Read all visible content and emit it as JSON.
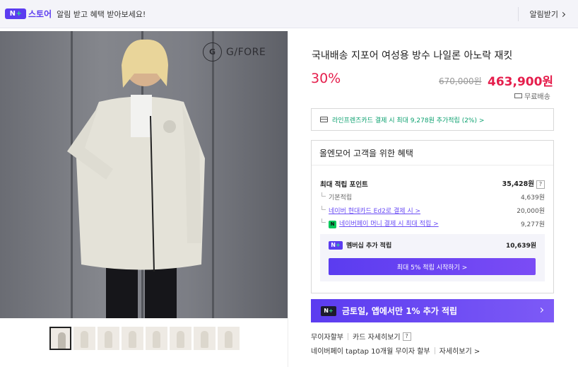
{
  "top_bar": {
    "badge": "N",
    "badge_plus": "+",
    "store_name": "스토어",
    "notice": "알림 받고 혜택 받아보세요!",
    "alarm_label": "알림받기"
  },
  "brand": {
    "logo_mark": "G",
    "name": "G/FORE"
  },
  "thumbnails": [
    {
      "active": true
    },
    {
      "active": false
    },
    {
      "active": false
    },
    {
      "active": false
    },
    {
      "active": false
    },
    {
      "active": false
    },
    {
      "active": false
    },
    {
      "active": false
    }
  ],
  "product": {
    "title": "국내배송 지포어 여성용 방수 나일론 아노락 재킷",
    "discount": "30%",
    "original_price": "670,000원",
    "sale_price": "463,900원",
    "shipping": "무료배송"
  },
  "card_offer": {
    "text": "라인프렌즈카드 결제 시 최대 9,278원 추가적립 (2%) >"
  },
  "benefit": {
    "heading": "올엔모어 고객을 위한 혜택",
    "max_points_label": "최대 적립 포인트",
    "max_points_value": "35,428원",
    "question": "?",
    "rows": [
      {
        "label": "기본적립",
        "value": "4,639원"
      },
      {
        "label": "네이버 현대카드 Ed2로 결제 시 >",
        "value": "20,000원"
      },
      {
        "label": "네이버페이 머니 결제 시 최대 적립 >",
        "value": "9,277원",
        "npay": "N"
      }
    ],
    "membership_label": "멤버십 추가 적립",
    "membership_value": "10,639원",
    "membership_button": "최대 5% 적립 시작하기 >"
  },
  "app_banner": {
    "text": "금토일, 앱에서만 1% 추가 적립"
  },
  "installments": {
    "line1_label": "무이자할부",
    "line1_link": "카드 자세히보기",
    "line1_q": "?",
    "line2_label": "네이버페이 taptap 10개월 무이자 할부",
    "line2_link": "자세히보기 >"
  },
  "colors": {
    "accent": "#5b3cf0",
    "price_red": "#e51e4c",
    "green": "#0aa06e"
  }
}
